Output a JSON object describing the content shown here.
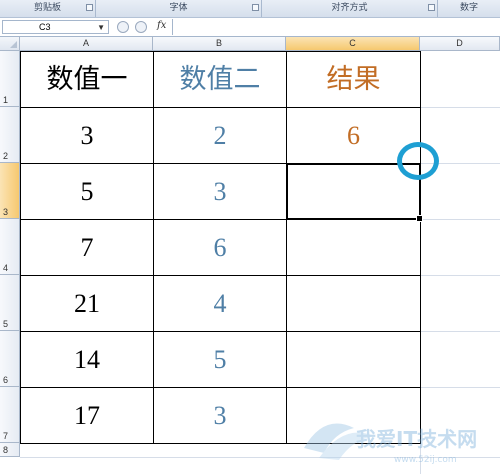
{
  "ribbon": {
    "groups": [
      {
        "label": "剪贴板"
      },
      {
        "label": "字体"
      },
      {
        "label": "对齐方式"
      },
      {
        "label": "数字"
      }
    ]
  },
  "formula_bar": {
    "name_box": "C3",
    "fx": "fx",
    "formula": ""
  },
  "columns": [
    "A",
    "B",
    "C",
    "D"
  ],
  "rows": [
    "1",
    "2",
    "3",
    "4",
    "5",
    "6",
    "7",
    "8"
  ],
  "table": {
    "headers": [
      "数值一",
      "数值二",
      "结果"
    ],
    "rows": [
      [
        "3",
        "2",
        "6"
      ],
      [
        "5",
        "3",
        ""
      ],
      [
        "7",
        "6",
        ""
      ],
      [
        "21",
        "4",
        ""
      ],
      [
        "14",
        "5",
        ""
      ],
      [
        "17",
        "3",
        ""
      ]
    ]
  },
  "colors": {
    "col_a_text": "#000000",
    "col_b_text": "#4f7fa6",
    "col_c_text": "#c26d25",
    "highlight_circle": "#1e9fd3",
    "selected_header": "#f6c86f"
  },
  "watermark": {
    "text": "我爱IT技术网",
    "url": "www.52ij.com"
  }
}
